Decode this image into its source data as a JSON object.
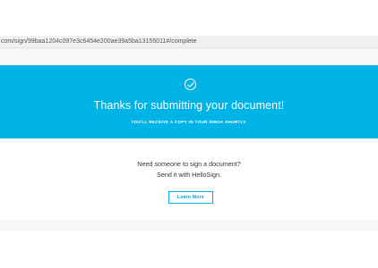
{
  "browser": {
    "url": "com/sign/99baa1204c097e3c6454e200ae39a5ba13155011#/complete"
  },
  "banner": {
    "icon": "checkmark-circle-icon",
    "title": "Thanks for submitting your document!",
    "subtitle": "YOU'LL RECEIVE A COPY IN YOUR INBOX SHORTLY.",
    "color": "#00b3e6"
  },
  "promo": {
    "line1": "Need someone to sign a document?",
    "line2": "Send it with HelloSign.",
    "button_label": "Learn More"
  }
}
